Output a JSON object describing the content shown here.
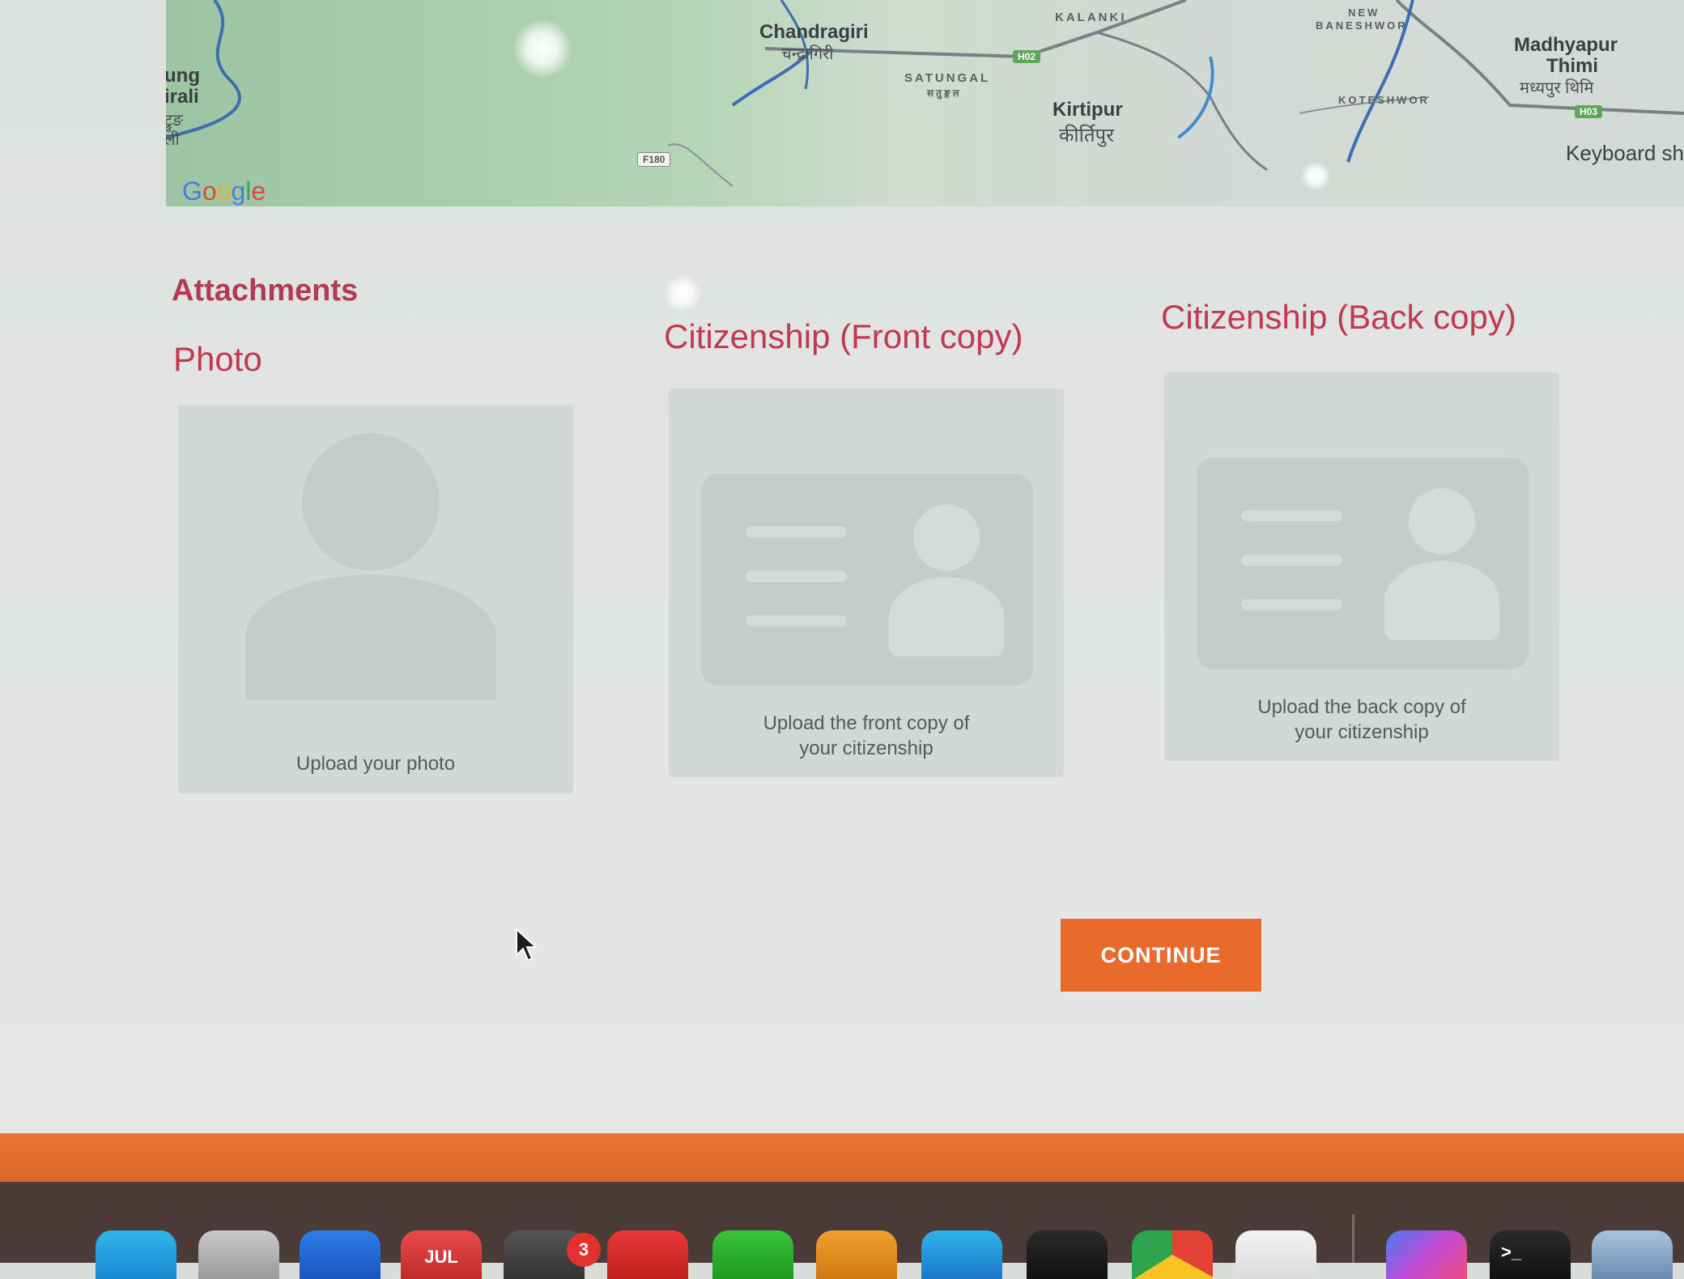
{
  "map": {
    "labels": {
      "chandragiri": "Chandragiri",
      "chandragiri_dev": "चन्द्रागिरी",
      "kalanki": "KALANKI",
      "satungal": "SATUNGAL",
      "satungal_dev": "सतुङ्गल",
      "kirtipur": "Kirtipur",
      "kirtipur_dev": "कीर्तिपुर",
      "new_baneshwor_1": "NEW",
      "new_baneshwor_2": "BANESHWOR",
      "koteshwor": "KOTESHWOR",
      "madhyapur": "Madhyapur",
      "thimi": "Thimi",
      "madhyapur_dev": "मध्यपुर थिमि",
      "left_edge_1": "ung",
      "left_edge_2": "irali",
      "left_edge_3": "ट्रुङ",
      "left_edge_4": "ली"
    },
    "road_badges": {
      "h02": "H02",
      "f180": "F180",
      "h03": "H03"
    },
    "google_logo": "Google",
    "keyboard_shortcuts": "Keyboard sh"
  },
  "attachments": {
    "title": "Attachments",
    "photo": {
      "title": "Photo",
      "caption": "Upload your photo"
    },
    "front": {
      "title": "Citizenship (Front copy)",
      "caption_1": "Upload the front copy of",
      "caption_2": "your citizenship"
    },
    "back": {
      "title": "Citizenship (Back copy)",
      "caption_1": "Upload the back copy of",
      "caption_2": "your citizenship"
    }
  },
  "continue_label": "CONTINUE",
  "dock": {
    "calendar_month": "JUL",
    "notification_count": "3",
    "terminal_prompt": ">_"
  },
  "colors": {
    "accent_title": "#c4384f",
    "button": "#e86b2b",
    "map_green": "#a9cfae"
  }
}
